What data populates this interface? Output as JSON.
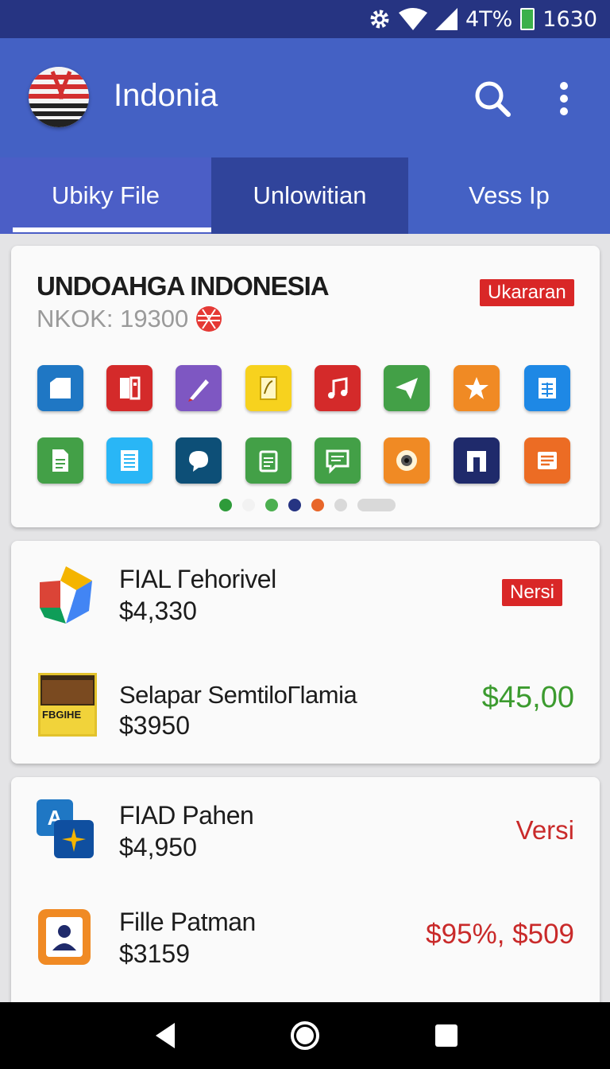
{
  "status_bar": {
    "signal_text": "4T%",
    "time": "1630",
    "icons": [
      "gear-icon",
      "wifi-icon",
      "signal-icon",
      "battery-icon"
    ]
  },
  "app_bar": {
    "title": "Indonia",
    "icons": [
      "app-logo",
      "search-icon",
      "more-vert-icon"
    ]
  },
  "tabs": [
    {
      "label": "Ubiky File",
      "selected": true
    },
    {
      "label": "Unlowitian",
      "selected": false
    },
    {
      "label": "Vess Ip",
      "selected": false
    }
  ],
  "hero": {
    "title": "UNDOAHGA INDONESIA",
    "subtitle": "NKOK: 19300",
    "badge": "Ukararan",
    "apps_row1": [
      {
        "icon": "folder-doc-icon",
        "color": "#1f77c4"
      },
      {
        "icon": "office-doc-icon",
        "color": "#d42a2a"
      },
      {
        "icon": "pen-icon",
        "color": "#7e57c2"
      },
      {
        "icon": "note-edit-icon",
        "color": "#f7d21e"
      },
      {
        "icon": "music-note-icon",
        "color": "#d42a2a"
      },
      {
        "icon": "send-icon",
        "color": "#43a047"
      },
      {
        "icon": "star-icon",
        "color": "#f08a24"
      },
      {
        "icon": "spreadsheet-icon",
        "color": "#1e88e5"
      }
    ],
    "apps_row2": [
      {
        "icon": "document-icon",
        "color": "#43a047"
      },
      {
        "icon": "text-lines-icon",
        "color": "#29b6f6"
      },
      {
        "icon": "chat-bubble-icon",
        "color": "#0d4f77"
      },
      {
        "icon": "clipboard-icon",
        "color": "#43a047"
      },
      {
        "icon": "message-icon",
        "color": "#43a047"
      },
      {
        "icon": "camera-eye-icon",
        "color": "#f08a24"
      },
      {
        "icon": "arch-icon",
        "color": "#1f2a6b"
      },
      {
        "icon": "news-icon",
        "color": "#ec6c24"
      }
    ],
    "pager": [
      "#2e9b3a",
      "#f2f2f2",
      "#4caf50",
      "#263482",
      "#e8662a",
      "#d9d9d9"
    ]
  },
  "list1": [
    {
      "title": "FIAL Гehorivel",
      "price": "$4,330",
      "right_badge": "Nersi",
      "icon": "colorful-cube-icon"
    },
    {
      "title": "Selapar SemtiloГlamia",
      "price": "$3950",
      "right_text": "$45,00",
      "right_color": "#3c9b2f",
      "icon": "game-box-icon",
      "box_text": "FBGIHE"
    }
  ],
  "list2": [
    {
      "title": "FIAD Pahen",
      "price": "$4,950",
      "right_text": "Versi",
      "right_color": "#c92a2a",
      "icon": "translate-icon",
      "icon_letter": "A"
    },
    {
      "title": "Fille Patman",
      "price": "$3159",
      "right_text": "$95%, $509",
      "right_color": "#c92a2a",
      "icon": "person-frame-icon"
    }
  ],
  "nav_bar": {
    "icons": [
      "back-icon",
      "home-icon",
      "recents-icon"
    ]
  }
}
